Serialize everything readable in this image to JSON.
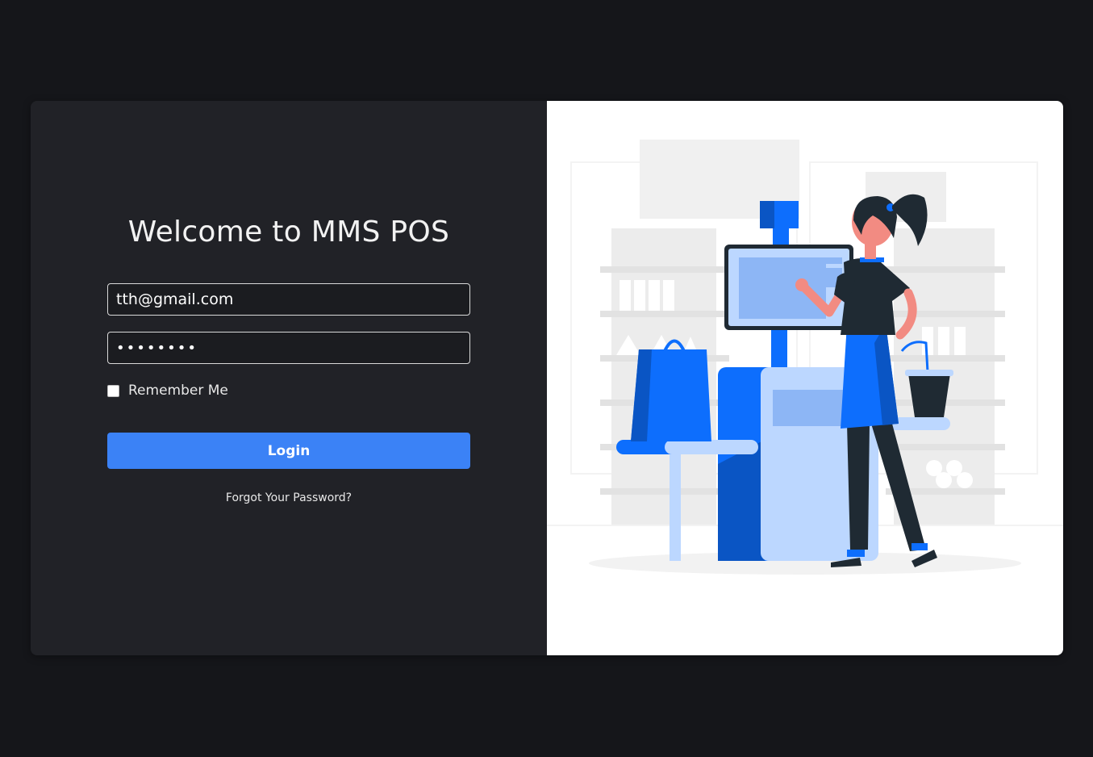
{
  "login": {
    "title": "Welcome to MMS POS",
    "email_value": "tth@gmail.com",
    "password_value": "••••••••",
    "remember_label": "Remember Me",
    "login_label": "Login",
    "forgot_label": "Forgot Your Password?"
  },
  "illustration": {
    "name": "self-checkout-kiosk-illustration",
    "colors": {
      "accent_blue": "#0d6efd",
      "light_blue": "#bcd7ff",
      "dark": "#1f2a33",
      "gray": "#e7e7e7"
    }
  },
  "colors": {
    "page_bg": "#15161a",
    "panel_bg": "#212227",
    "button_bg": "#3b82f6"
  }
}
